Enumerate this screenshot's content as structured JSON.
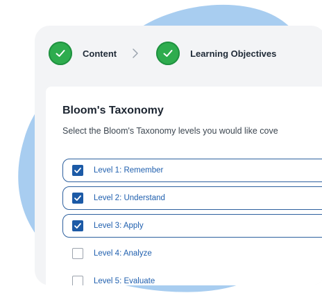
{
  "stepper": {
    "steps": [
      {
        "label": "Content",
        "status": "complete",
        "icon": "check-icon"
      },
      {
        "label": "Learning Objectives",
        "status": "complete",
        "icon": "check-icon"
      }
    ],
    "separator_icon": "chevron-right-icon"
  },
  "panel": {
    "title": "Bloom's Taxonomy",
    "description": "Select the Bloom's Taxonomy levels you would like cove"
  },
  "levels": [
    {
      "label": "Level 1: Remember",
      "checked": true
    },
    {
      "label": "Level 2: Understand",
      "checked": true
    },
    {
      "label": "Level 3: Apply",
      "checked": true
    },
    {
      "label": "Level 4: Analyze",
      "checked": false
    },
    {
      "label": "Level 5: Evaluate",
      "checked": false
    }
  ],
  "colors": {
    "background_blob": "#a8cdf0",
    "step_complete": "#2eac4e",
    "accent": "#1c5aa6",
    "card": "#f3f4f6",
    "panel": "#ffffff"
  }
}
